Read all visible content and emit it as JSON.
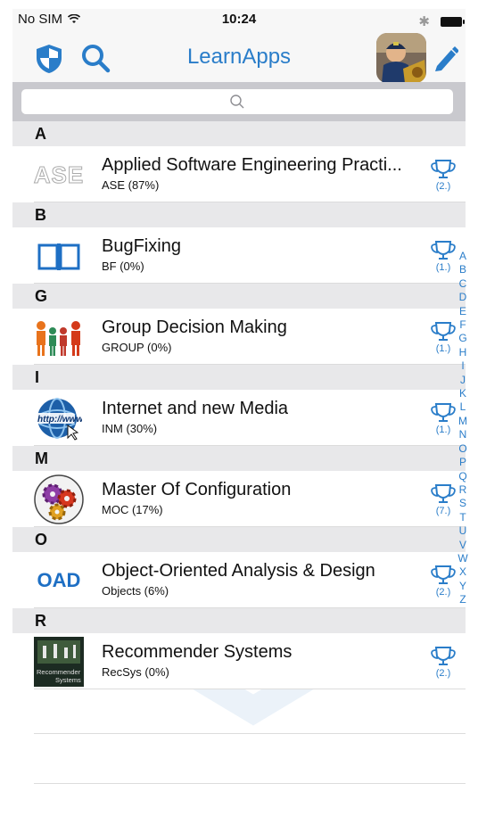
{
  "status": {
    "carrier": "No SIM",
    "time": "10:24"
  },
  "nav": {
    "title": "LearnApps"
  },
  "search": {
    "placeholder": ""
  },
  "sections": [
    {
      "letter": "A",
      "app": {
        "title": "Applied Software Engineering Practi...",
        "subtitle": "ASE (87%)",
        "rank": "(2.)",
        "icon": "ase-logo"
      }
    },
    {
      "letter": "B",
      "app": {
        "title": "BugFixing",
        "subtitle": "BF (0%)",
        "rank": "(1.)",
        "icon": "open-book-icon"
      }
    },
    {
      "letter": "G",
      "app": {
        "title": "Group Decision Making",
        "subtitle": "GROUP (0%)",
        "rank": "(1.)",
        "icon": "people-group-icon"
      }
    },
    {
      "letter": "I",
      "app": {
        "title": "Internet and new Media",
        "subtitle": "INM (30%)",
        "rank": "(1.)",
        "icon": "globe-http-icon"
      }
    },
    {
      "letter": "M",
      "app": {
        "title": "Master Of Configuration",
        "subtitle": "MOC (17%)",
        "rank": "(7.)",
        "icon": "gears-icon"
      }
    },
    {
      "letter": "O",
      "app": {
        "title": "Object-Oriented Analysis & Design",
        "subtitle": "Objects (6%)",
        "rank": "(2.)",
        "icon": "oad-logo",
        "icon_text": "OAD"
      }
    },
    {
      "letter": "R",
      "app": {
        "title": "Recommender Systems",
        "subtitle": "RecSys (0%)",
        "rank": "(2.)",
        "icon": "recommender-cover",
        "icon_text_1": "Recommender",
        "icon_text_2": "Systems"
      }
    }
  ],
  "index_letters": [
    "A",
    "B",
    "C",
    "D",
    "E",
    "F",
    "G",
    "H",
    "I",
    "J",
    "K",
    "L",
    "M",
    "N",
    "O",
    "P",
    "Q",
    "R",
    "S",
    "T",
    "U",
    "V",
    "W",
    "X",
    "Y",
    "Z"
  ],
  "colors": {
    "accent": "#2a7dc9",
    "section_bg": "#e8e8ea",
    "navbar_bg": "#f7f7f7"
  }
}
